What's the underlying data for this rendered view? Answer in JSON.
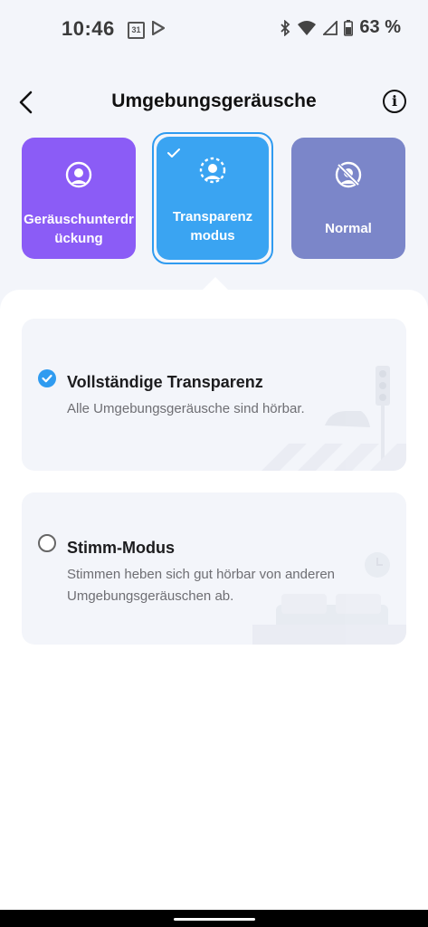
{
  "status_bar": {
    "time": "10:46",
    "calendar_day": "31",
    "battery": "63 %"
  },
  "header": {
    "title": "Umgebungsgeräusche"
  },
  "modes": [
    {
      "id": "anc",
      "label": "Geräuschunterdr\nückung",
      "icon": "noise-cancel-icon",
      "color": "#8b5cf6",
      "selected": false
    },
    {
      "id": "transparency",
      "label": "Transparenz\nmodus",
      "icon": "transparency-icon",
      "color": "#3aa4f2",
      "selected": true
    },
    {
      "id": "normal",
      "label": "Normal",
      "icon": "normal-off-icon",
      "color": "#7b86c9",
      "selected": false
    }
  ],
  "options": [
    {
      "title": "Vollständige Transparenz",
      "description": "Alle Umgebungsgeräusche sind hörbar.",
      "selected": true
    },
    {
      "title": "Stimm-Modus",
      "description": "Stimmen heben sich gut hörbar von anderen Umgebungsgeräuschen ab.",
      "selected": false
    }
  ],
  "colors": {
    "accent": "#2f9bf0",
    "background": "#f3f5fa"
  }
}
